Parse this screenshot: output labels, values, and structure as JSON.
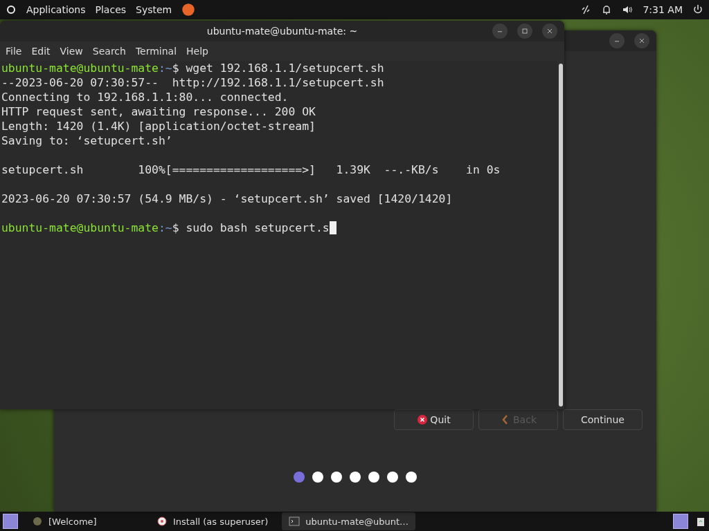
{
  "top_panel": {
    "menus": [
      "Applications",
      "Places",
      "System"
    ],
    "clock": "7:31 AM"
  },
  "installer": {
    "buttons": [
      {
        "label": "Quit",
        "kind": "quit",
        "disabled": false
      },
      {
        "label": "Back",
        "kind": "back",
        "disabled": true
      },
      {
        "label": "Continue",
        "kind": "plain",
        "disabled": false
      }
    ],
    "steps": [
      {
        "selected": true
      },
      {
        "selected": false
      },
      {
        "selected": false
      },
      {
        "selected": false
      },
      {
        "selected": false
      },
      {
        "selected": false
      },
      {
        "selected": false
      }
    ]
  },
  "terminal": {
    "title": "ubuntu-mate@ubuntu-mate: ~",
    "menu": [
      "File",
      "Edit",
      "View",
      "Search",
      "Terminal",
      "Help"
    ],
    "lines": [
      {
        "kind": "prompt",
        "user": "ubuntu-mate@ubuntu-mate",
        "path": ":~",
        "command": "$ wget 192.168.1.1/setupcert.sh",
        "cursor": false
      },
      {
        "kind": "output",
        "text": "--2023-06-20 07:30:57--  http://192.168.1.1/setupcert.sh"
      },
      {
        "kind": "output",
        "text": "Connecting to 192.168.1.1:80... connected."
      },
      {
        "kind": "output",
        "text": "HTTP request sent, awaiting response... 200 OK"
      },
      {
        "kind": "output",
        "text": "Length: 1420 (1.4K) [application/octet-stream]"
      },
      {
        "kind": "output",
        "text": "Saving to: ‘setupcert.sh’"
      },
      {
        "kind": "blank"
      },
      {
        "kind": "output",
        "text": "setupcert.sh        100%[===================>]   1.39K  --.-KB/s    in 0s"
      },
      {
        "kind": "blank"
      },
      {
        "kind": "output",
        "text": "2023-06-20 07:30:57 (54.9 MB/s) - ‘setupcert.sh’ saved [1420/1420]"
      },
      {
        "kind": "blank"
      },
      {
        "kind": "prompt",
        "user": "ubuntu-mate@ubuntu-mate",
        "path": ":~",
        "command": "$ sudo bash setupcert.s",
        "cursor": true
      }
    ]
  },
  "taskbar": {
    "items": [
      {
        "label": "[Welcome]",
        "kind": "welcome",
        "selected": false
      },
      {
        "label": "Install (as superuser)",
        "kind": "install",
        "selected": false
      },
      {
        "label": "ubuntu-mate@ubunt…",
        "kind": "terminal",
        "selected": true
      }
    ]
  }
}
